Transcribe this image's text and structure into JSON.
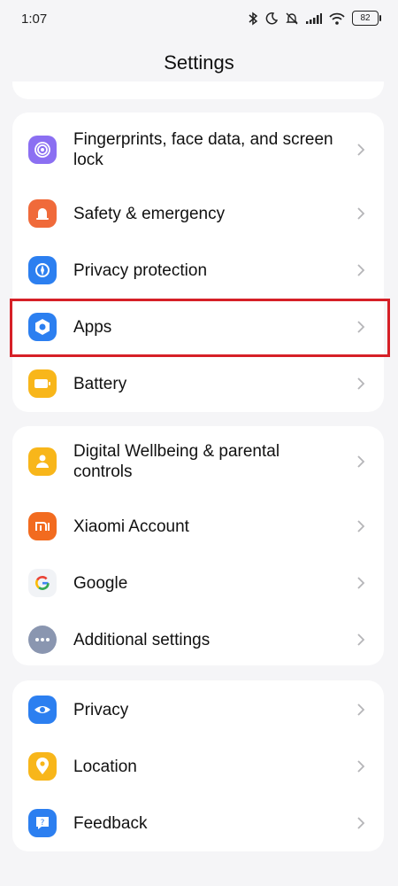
{
  "status_bar": {
    "time": "1:07",
    "battery": "82"
  },
  "header": {
    "title": "Settings"
  },
  "groups": [
    {
      "items": [
        {
          "label": "Fingerprints, face data, and screen lock",
          "icon": "fingerprint-icon",
          "color": "#8b6ff2"
        },
        {
          "label": "Safety & emergency",
          "icon": "alarm-bell-icon",
          "color": "#f06a3a"
        },
        {
          "label": "Privacy protection",
          "icon": "privacy-shield-icon",
          "color": "#2c7ff0"
        },
        {
          "label": "Apps",
          "icon": "apps-hexagon-icon",
          "color": "#2c7ff0",
          "highlighted": true
        },
        {
          "label": "Battery",
          "icon": "battery-icon",
          "color": "#f8b61a"
        }
      ]
    },
    {
      "items": [
        {
          "label": "Digital Wellbeing & parental controls",
          "icon": "wellbeing-person-icon",
          "color": "#f8b61a"
        },
        {
          "label": "Xiaomi Account",
          "icon": "xiaomi-mi-icon",
          "color": "#f26b1f"
        },
        {
          "label": "Google",
          "icon": "google-g-icon",
          "color": "#4285f4"
        },
        {
          "label": "Additional settings",
          "icon": "more-dots-icon",
          "color": "#8a96b0"
        }
      ]
    },
    {
      "items": [
        {
          "label": "Privacy",
          "icon": "eye-icon",
          "color": "#2c7ff0"
        },
        {
          "label": "Location",
          "icon": "location-pin-icon",
          "color": "#f8b61a"
        },
        {
          "label": "Feedback",
          "icon": "feedback-icon",
          "color": "#2c7ff0"
        }
      ]
    }
  ],
  "highlight_color": "#d62027"
}
